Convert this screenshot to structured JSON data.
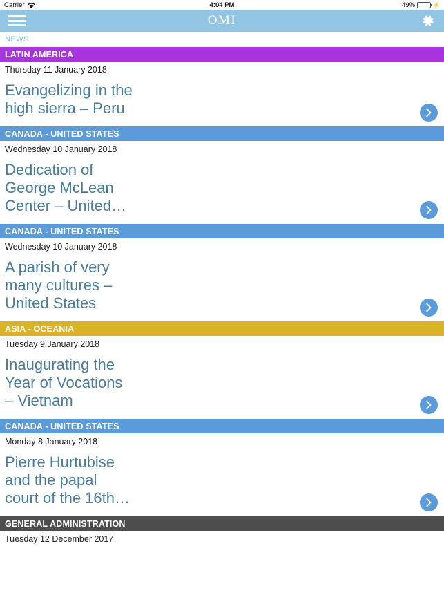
{
  "status_bar": {
    "carrier": "Carrier",
    "wifi_icon": "wifi-icon",
    "time": "4:04 PM",
    "battery_percent": "49%",
    "battery_level": 49,
    "charging_icon": "lightning-bolt-icon"
  },
  "navbar": {
    "menu_icon": "hamburger-menu-icon",
    "brand": "OMI",
    "settings_icon": "gear-icon",
    "background": "#92C5E3"
  },
  "page": {
    "label": "NEWS",
    "label_color": "#7FB6D9"
  },
  "category_colors": {
    "latin_america": "#A835DC",
    "canada_united_states": "#5B9BD9",
    "asia_oceania": "#D9B327",
    "general_administration": "#4D4D4D"
  },
  "feed": {
    "items": [
      {
        "category": "LATIN AMERICA",
        "category_color": "#A835DC",
        "date": "Thursday 11 January 2018",
        "title": "Evangelizing in the\nhigh sierra – Peru",
        "chevron_icon": "chevron-right-icon"
      },
      {
        "category": "CANADA - UNITED STATES",
        "category_color": "#5B9BD9",
        "date": "Wednesday 10 January 2018",
        "title": "Dedication of\nGeorge McLean\nCenter – United…",
        "chevron_icon": "chevron-right-icon"
      },
      {
        "category": "CANADA - UNITED STATES",
        "category_color": "#5B9BD9",
        "date": "Wednesday 10 January 2018",
        "title": "A parish of very\nmany cultures –\nUnited States",
        "chevron_icon": "chevron-right-icon"
      },
      {
        "category": "ASIA - OCEANIA",
        "category_color": "#D9B327",
        "date": "Tuesday 9 January 2018",
        "title": "Inaugurating the\nYear of Vocations\n– Vietnam",
        "chevron_icon": "chevron-right-icon"
      },
      {
        "category": "CANADA - UNITED STATES",
        "category_color": "#5B9BD9",
        "date": "Monday 8 January 2018",
        "title": "Pierre Hurtubise\nand the papal\ncourt of the 16th…",
        "chevron_icon": "chevron-right-icon"
      },
      {
        "category": "GENERAL ADMINISTRATION",
        "category_color": "#4D4D4D",
        "date": "Tuesday 12 December 2017",
        "title": "",
        "chevron_icon": "chevron-right-icon"
      }
    ]
  }
}
